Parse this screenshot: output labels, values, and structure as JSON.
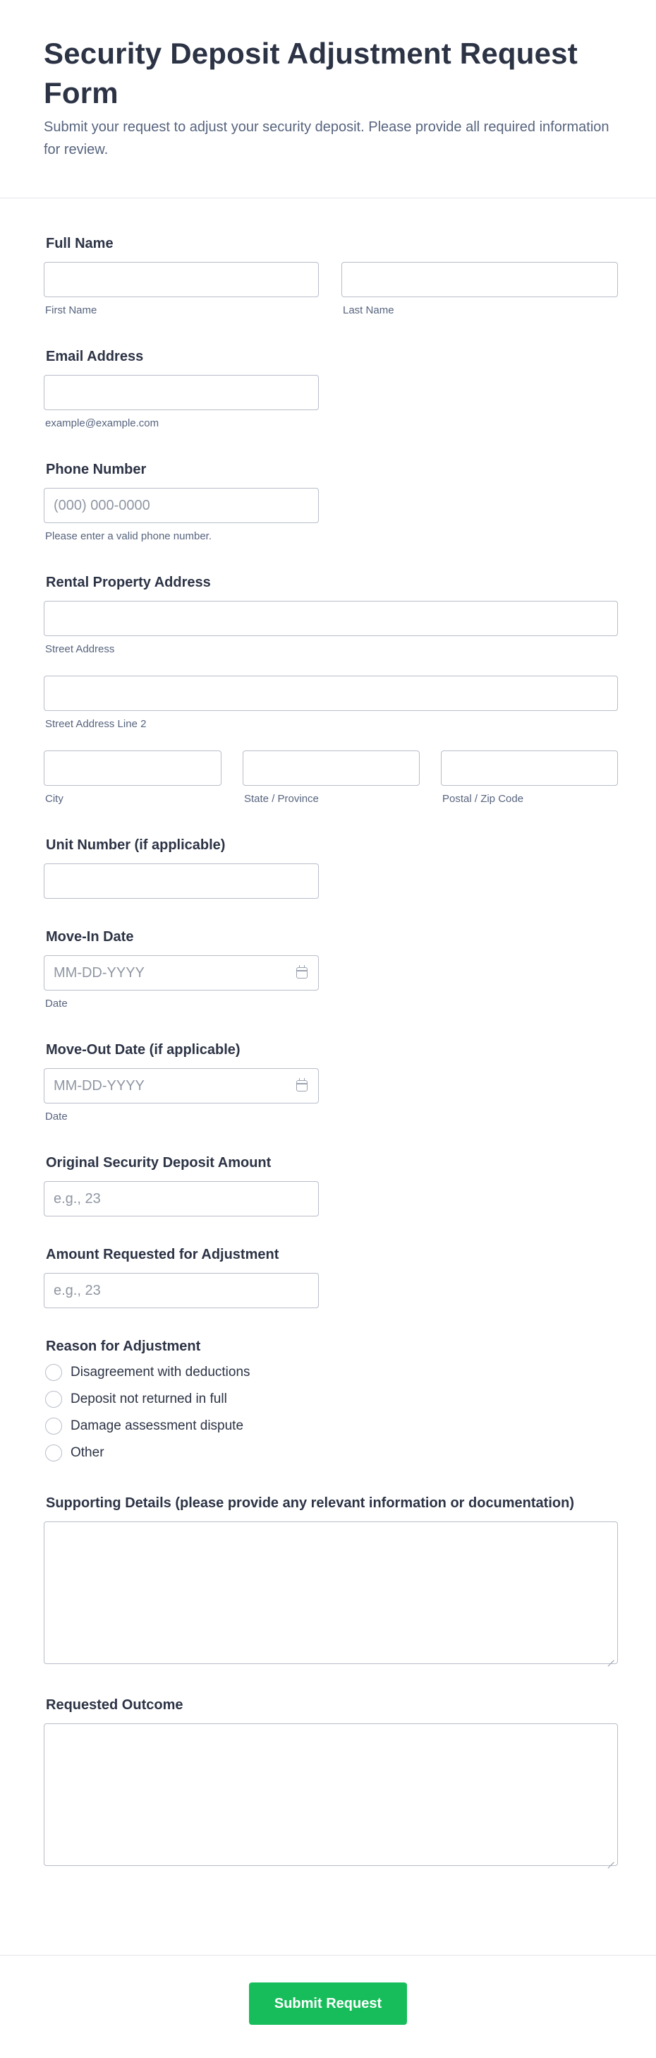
{
  "form": {
    "title": "Security Deposit Adjustment Request Form",
    "description": "Submit your request to adjust your security deposit. Please provide all required information for review."
  },
  "full_name": {
    "label": "Full Name",
    "first_sublabel": "First Name",
    "last_sublabel": "Last Name",
    "first_value": "",
    "last_value": ""
  },
  "email": {
    "label": "Email Address",
    "sublabel": "example@example.com",
    "value": ""
  },
  "phone": {
    "label": "Phone Number",
    "placeholder": "(000) 000-0000",
    "sublabel": "Please enter a valid phone number."
  },
  "address": {
    "label": "Rental Property Address",
    "street_sublabel": "Street Address",
    "street2_sublabel": "Street Address Line 2",
    "city_sublabel": "City",
    "state_sublabel": "State / Province",
    "zip_sublabel": "Postal / Zip Code"
  },
  "unit": {
    "label": "Unit Number (if applicable)",
    "value": ""
  },
  "move_in": {
    "label": "Move-In Date",
    "placeholder": "MM-DD-YYYY",
    "sublabel": "Date",
    "icon": "calendar-icon"
  },
  "move_out": {
    "label": "Move-Out Date (if applicable)",
    "placeholder": "MM-DD-YYYY",
    "sublabel": "Date",
    "icon": "calendar-icon"
  },
  "original_deposit": {
    "label": "Original Security Deposit Amount",
    "placeholder": "e.g., 23"
  },
  "requested_amount": {
    "label": "Amount Requested for Adjustment",
    "placeholder": "e.g., 23"
  },
  "reason": {
    "label": "Reason for Adjustment",
    "options": [
      "Disagreement with deductions",
      "Deposit not returned in full",
      "Damage assessment dispute",
      "Other"
    ]
  },
  "details": {
    "label": "Supporting Details (please provide any relevant information or documentation)",
    "value": ""
  },
  "outcome": {
    "label": "Requested Outcome",
    "value": ""
  },
  "submit": {
    "label": "Submit Request"
  },
  "colors": {
    "text": "#2c3345",
    "subtext": "#57647e",
    "border": "#b8bdc9",
    "submit": "#18bd5b"
  }
}
